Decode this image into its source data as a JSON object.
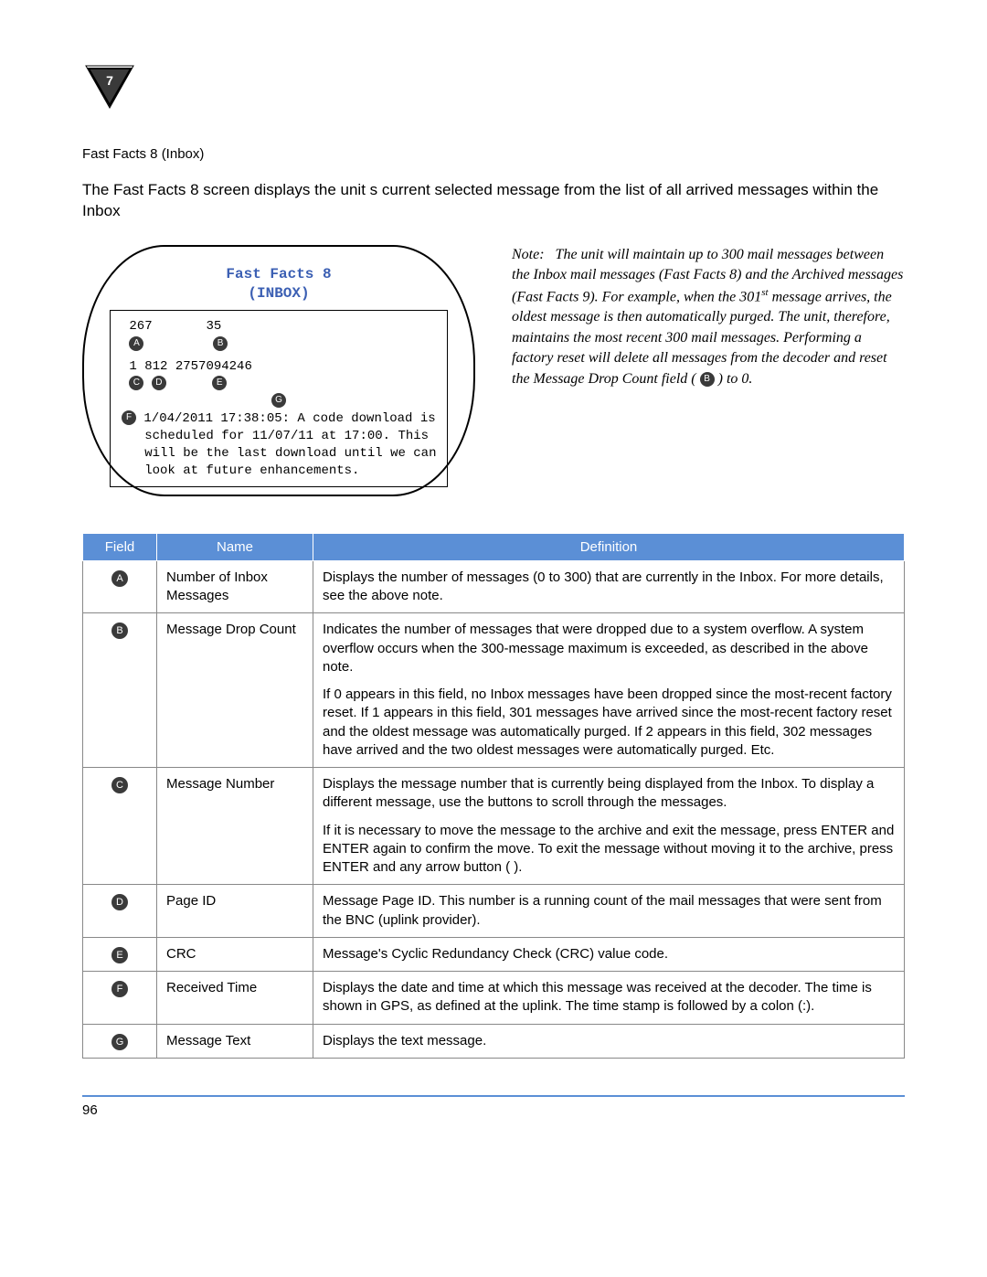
{
  "chapter_number": "7",
  "section_title": "Fast Facts 8 (Inbox)",
  "intro_text": "The Fast Facts 8 screen displays the unit s current selected message from the list of all arrived messages within the Inbox",
  "screen": {
    "title_line1": "Fast Facts 8",
    "title_line2": "(INBOX)",
    "valA": "267",
    "valB": "35",
    "valC": "1",
    "valD": "812",
    "valE": "2757094246",
    "msg_line1": "1/04/2011 17:38:05: A code download is",
    "msg_line2": "scheduled for 11/07/11 at 17:00. This",
    "msg_line3": "will be the last download until we can",
    "msg_line4": "look at future enhancements."
  },
  "note": {
    "lead": "Note:",
    "body_pre": "The unit will maintain up to 300 mail messages between the Inbox mail messages (Fast Facts 8) and the Archived messages (Fast Facts 9). For example, when the 301",
    "sup": "st",
    "body_post": " message arrives, the oldest message is then automatically purged. The unit, therefore, maintains the most recent 300 mail messages. Performing a factory reset will delete all messages from the decoder and reset the Message Drop Count field ( ",
    "bullet": "B",
    "body_tail": " ) to 0."
  },
  "table_headers": {
    "field": "Field",
    "name": "Name",
    "definition": "Definition"
  },
  "rows": [
    {
      "letter": "A",
      "name": "Number of Inbox Messages",
      "defs": [
        "Displays the number of messages (0 to 300) that are currently in the Inbox. For more details, see the above note."
      ]
    },
    {
      "letter": "B",
      "name": "Message Drop Count",
      "defs": [
        "Indicates the number of messages that were dropped due to a system overflow. A system overflow occurs when the 300-message maximum is exceeded, as described in the above note.",
        "If 0 appears in this field, no Inbox messages have been dropped since the most-recent factory reset. If 1 appears in this field, 301 messages have arrived since the most-recent factory reset and the oldest message was automatically purged. If 2 appears in this field, 302 messages have arrived and the two oldest messages were automatically purged. Etc."
      ]
    },
    {
      "letter": "C",
      "name": "Message Number",
      "defs": [
        "Displays the message number that is currently being displayed from the Inbox. To display a different message, use the          buttons to scroll through the messages.",
        "If it is necessary to move the message to the archive and exit the message, press ENTER and ENTER again to confirm the move. To exit the message without moving it to the archive, press ENTER and any arrow button (                )."
      ]
    },
    {
      "letter": "D",
      "name": "Page ID",
      "defs": [
        "Message Page ID. This number is a running count of the mail messages that were sent from the BNC (uplink provider)."
      ]
    },
    {
      "letter": "E",
      "name": "CRC",
      "defs": [
        "Message's Cyclic Redundancy Check (CRC) value code."
      ]
    },
    {
      "letter": "F",
      "name": "Received Time",
      "defs": [
        "Displays the date and time at which this message was received at the decoder. The time is shown in GPS, as defined at the uplink. The time stamp is followed by a colon (:)."
      ]
    },
    {
      "letter": "G",
      "name": "Message Text",
      "defs": [
        "Displays the text message."
      ]
    }
  ],
  "page_number": "96"
}
